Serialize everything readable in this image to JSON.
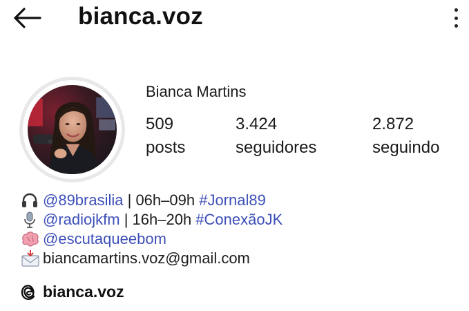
{
  "header": {
    "back_icon": "arrow-left-icon",
    "username": "bianca.voz",
    "more_icon": "more-vertical-icon"
  },
  "profile": {
    "full_name": "Bianca Martins",
    "stats": [
      {
        "value": "509",
        "label": "posts"
      },
      {
        "value": "3.424",
        "label": "seguidores"
      },
      {
        "value": "2.872",
        "label": "seguindo"
      }
    ]
  },
  "bio": {
    "line1": {
      "icon": "headphones-emoji",
      "mention": "@89brasilia",
      "text": " | 06h–09h ",
      "hashtag": "#Jornal89"
    },
    "line2": {
      "icon": "microphone-emoji",
      "mention": "@radiojkfm",
      "text": " | 16h–20h ",
      "hashtag": "#ConexãoJK"
    },
    "line3": {
      "icon": "brain-emoji",
      "mention": "@escutaqueebom"
    },
    "line4": {
      "icon": "incoming-envelope-emoji",
      "text": "biancamartins.voz@gmail.com"
    }
  },
  "threads": {
    "icon": "threads-icon",
    "label": "bianca.voz"
  },
  "colors": {
    "link": "#3d4fb8",
    "text": "#1c1c1c",
    "background": "#ffffff"
  }
}
